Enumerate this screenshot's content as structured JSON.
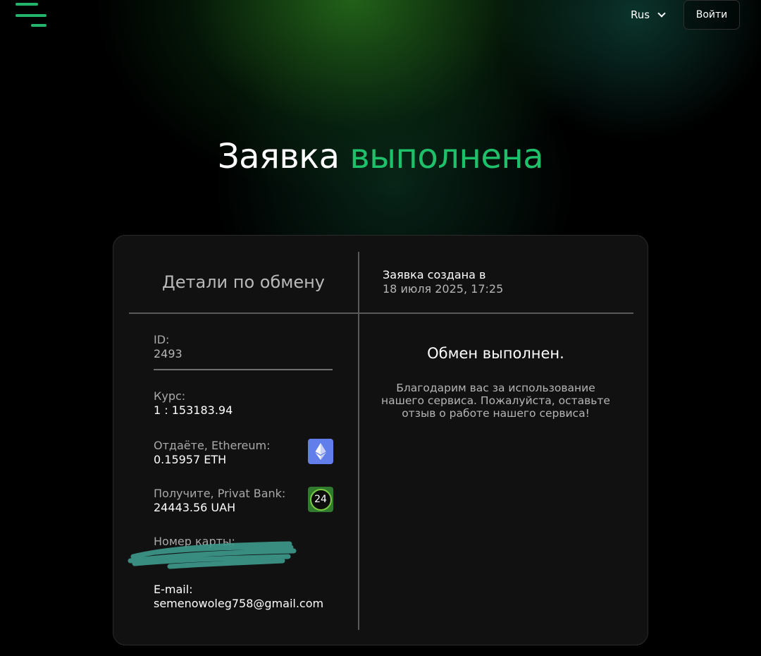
{
  "header": {
    "language": "Rus",
    "login_label": "Войти"
  },
  "hero": {
    "title_prefix": "Заявка",
    "title_accent": "выполнена"
  },
  "card": {
    "details_heading": "Детали по обмену",
    "created_label": "Заявка создана в",
    "created_value": "18 июля 2025, 17:25",
    "fields": {
      "id": {
        "label": "ID:",
        "value": "2493"
      },
      "rate": {
        "label": "Курс:",
        "value": "1 : 153183.94"
      },
      "give": {
        "label": "Отдаёте, Ethereum:",
        "value": "0.15957 ETH",
        "icon": "ethereum-icon"
      },
      "receive": {
        "label": "Получите, Privat Bank:",
        "value": "24443.56 UAH",
        "icon": "privat24-icon",
        "icon_text": "24"
      },
      "card_number": {
        "label": "Номер карты:"
      },
      "email": {
        "label": "E-mail:",
        "value": "semenowoleg758@gmail.com"
      }
    },
    "status_title": "Обмен выполнен.",
    "status_text": "Благодарим вас за использование нашего сервиса. Пожалуйста, оставьте отзыв о работе нашего сервиса!"
  },
  "colors": {
    "accent_green": "#1ec06a",
    "menu_green": "#23b36a",
    "card_bg": "#111111",
    "ethereum_blue": "#627eea",
    "redaction_teal": "#3d9a8d"
  }
}
